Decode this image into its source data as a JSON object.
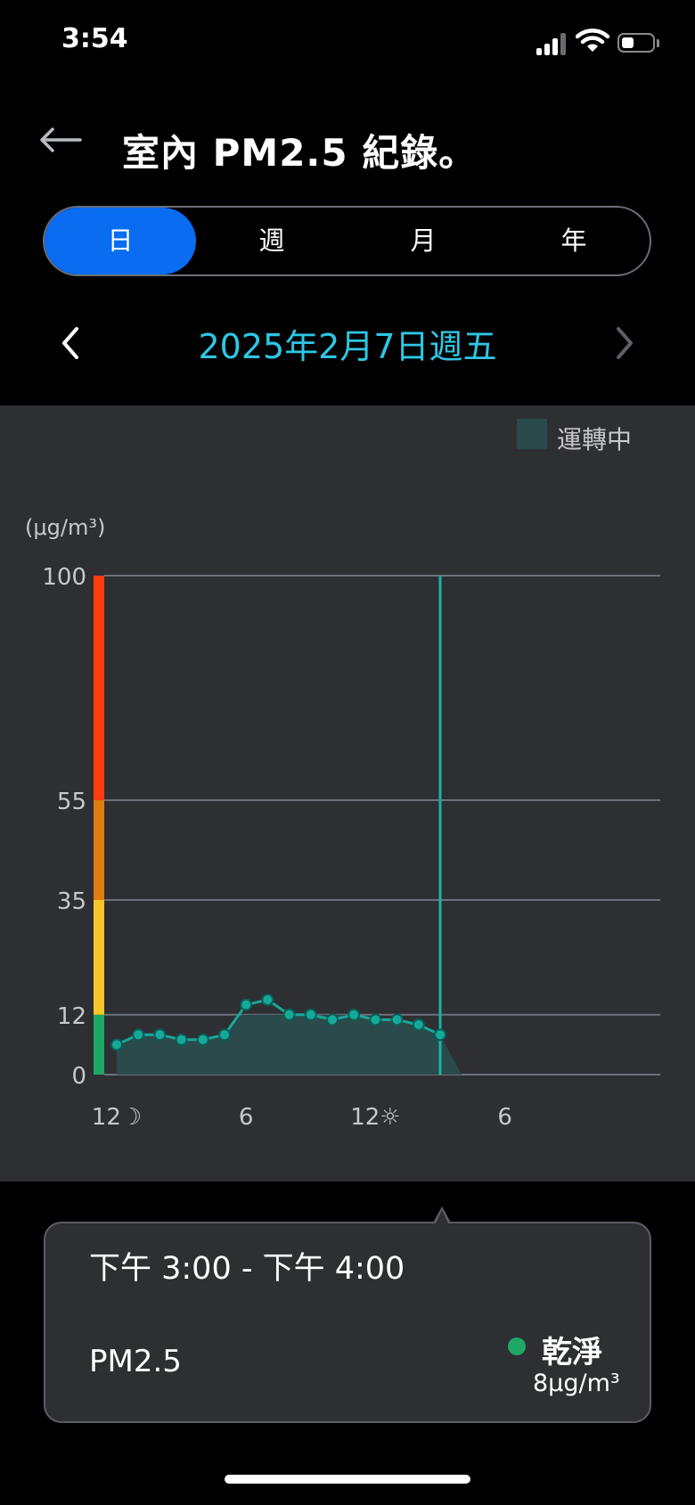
{
  "status_bar": {
    "time": "3:54",
    "icons": [
      "cellular-signal-icon",
      "wifi-icon",
      "battery-icon"
    ]
  },
  "header": {
    "back_icon": "back-arrow-icon",
    "title": "室內 PM2.5 紀錄。"
  },
  "period_tabs": {
    "selected": "日",
    "items": [
      {
        "label": "日"
      },
      {
        "label": "週"
      },
      {
        "label": "月"
      },
      {
        "label": "年"
      }
    ]
  },
  "date_nav": {
    "label": "2025年2月7日週五",
    "prev_icon": "chevron-left-icon",
    "next_icon": "chevron-right-icon"
  },
  "colors": {
    "accent": "#0a6cf0",
    "date_text": "#2ec7e4",
    "series": "#16a99a",
    "cursor": "#19b3a6",
    "running_fill": "#2a4a4b",
    "band_good": "#1ea866",
    "band_moderate": "#f5c72a",
    "band_unhealthy_sensitive": "#e07c10",
    "band_unhealthy": "#ff3d0e",
    "panel": "#2d2f33"
  },
  "chart_data": {
    "type": "line",
    "legend": [
      {
        "label": "運轉中",
        "position": "top-right"
      }
    ],
    "ylabel": "(μg/m³)",
    "ylim": [
      0,
      100
    ],
    "y_ticks": [
      0,
      12,
      35,
      55,
      100
    ],
    "xlim": [
      0,
      24
    ],
    "x_ticks": [
      {
        "x": 0,
        "label": "12☽"
      },
      {
        "x": 6,
        "label": "6"
      },
      {
        "x": 12,
        "label": "12☼"
      },
      {
        "x": 18,
        "label": "6"
      }
    ],
    "aqi_bands": [
      {
        "from": 0,
        "to": 12,
        "color": "#1ea866"
      },
      {
        "from": 12,
        "to": 35,
        "color": "#f5c72a"
      },
      {
        "from": 35,
        "to": 55,
        "color": "#e07c10"
      },
      {
        "from": 55,
        "to": 100,
        "color": "#ff3d0e"
      }
    ],
    "series": [
      {
        "x": [
          0,
          1,
          2,
          3,
          4,
          5,
          6,
          7,
          8,
          9,
          10,
          11,
          12,
          13,
          14,
          15
        ],
        "y": [
          6,
          8,
          8,
          7,
          7,
          8,
          14,
          15,
          12,
          12,
          11,
          12,
          11,
          11,
          10,
          8
        ]
      }
    ],
    "running_area": {
      "x": [
        0,
        1,
        2,
        3,
        4,
        5,
        5.8,
        7,
        8,
        9,
        10,
        11,
        12,
        13,
        14,
        15,
        16
      ],
      "y": [
        6,
        8,
        8,
        7,
        7,
        8,
        12,
        12,
        12,
        12,
        12,
        12,
        11,
        11,
        10,
        8,
        0
      ]
    },
    "cursor_x": 15,
    "grid": true
  },
  "tooltip": {
    "time_range": "下午 3:00 - 下午 4:00",
    "metric": "PM2.5",
    "status": "乾淨",
    "value": "8μg/m³"
  }
}
